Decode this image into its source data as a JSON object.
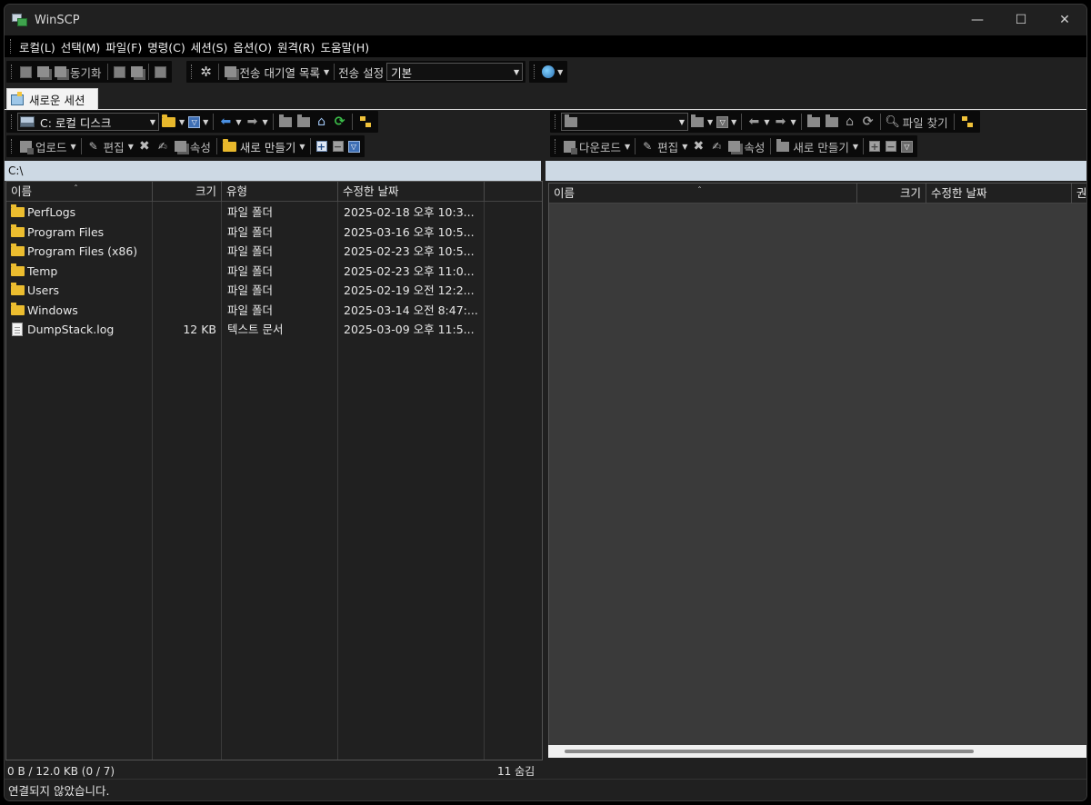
{
  "window": {
    "title": "WinSCP",
    "minimize": "—",
    "maximize": "☐",
    "close": "✕"
  },
  "menu": [
    "로컬(L)",
    "선택(M)",
    "파일(F)",
    "명령(C)",
    "세션(S)",
    "옵션(O)",
    "원격(R)",
    "도움말(H)"
  ],
  "toolbar": {
    "sync_label": "동기화",
    "queue_label": "전송 대기열 목록",
    "transfer_settings_label": "전송 설정",
    "transfer_preset": "기본"
  },
  "tabs": [
    {
      "label": "새로운 세션"
    }
  ],
  "local": {
    "drive": "C: 로컬 디스크",
    "actions": {
      "upload": "업로드",
      "edit": "편집",
      "properties": "속성",
      "new": "새로 만들기"
    },
    "path": "C:\\",
    "columns": [
      "이름",
      "크기",
      "유형",
      "수정한 날짜"
    ],
    "rows": [
      {
        "name": "PerfLogs",
        "size": "",
        "type": "파일 폴더",
        "date": "2025-02-18  오후 10:3...",
        "kind": "folder"
      },
      {
        "name": "Program Files",
        "size": "",
        "type": "파일 폴더",
        "date": "2025-03-16  오후 10:5...",
        "kind": "folder"
      },
      {
        "name": "Program Files (x86)",
        "size": "",
        "type": "파일 폴더",
        "date": "2025-02-23  오후 10:5...",
        "kind": "folder"
      },
      {
        "name": "Temp",
        "size": "",
        "type": "파일 폴더",
        "date": "2025-02-23  오후 11:0...",
        "kind": "folder"
      },
      {
        "name": "Users",
        "size": "",
        "type": "파일 폴더",
        "date": "2025-02-19  오전 12:2...",
        "kind": "folder"
      },
      {
        "name": "Windows",
        "size": "",
        "type": "파일 폴더",
        "date": "2025-03-14  오전 8:47:...",
        "kind": "folder"
      },
      {
        "name": "DumpStack.log",
        "size": "12 KB",
        "type": "텍스트 문서",
        "date": "2025-03-09  오후 11:5...",
        "kind": "file"
      }
    ],
    "status_left": "0 B / 12.0 KB (0 / 7)",
    "status_right": "11 숨김"
  },
  "remote": {
    "drive": "",
    "find_files": "파일 찾기",
    "actions": {
      "download": "다운로드",
      "edit": "편집",
      "properties": "속성",
      "new": "새로 만들기"
    },
    "path": "",
    "columns": [
      "이름",
      "크기",
      "수정한 날짜",
      "권"
    ]
  },
  "statusbar": {
    "text": "연결되지 않았습니다."
  }
}
